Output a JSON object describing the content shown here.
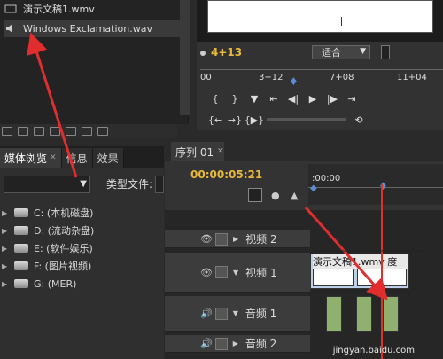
{
  "project": {
    "items": [
      {
        "label": "演示文稿1.wmv",
        "icon": "video-file-icon"
      },
      {
        "label": "Windows Exclamation.wav",
        "icon": "audio-file-icon"
      }
    ]
  },
  "media_browser": {
    "tabs": [
      {
        "label": "媒体浏览",
        "active": true
      },
      {
        "label": "信息",
        "active": false
      },
      {
        "label": "效果",
        "active": false
      }
    ],
    "type_label": "类型文件:",
    "drives": [
      "C: (本机磁盘)",
      "D: (流动杂盘)",
      "E: (软件娱乐)",
      "F: (图片视频)",
      "G: (MER)"
    ]
  },
  "monitor": {
    "timecode": "4+13",
    "fit": "适合",
    "ruler": [
      "00",
      "3+12",
      "7+08",
      "11+04"
    ]
  },
  "sequence": {
    "tab_label": "序列 01",
    "timecode": "00:00:05:21",
    "ruler_tc": ":00:00",
    "tracks": {
      "video2": "视频 2",
      "video1": "视频 1",
      "audio1": "音频 1",
      "audio2": "音频 2"
    },
    "side_label": "V",
    "clip_name": "演示文稿1.wmv 度"
  },
  "watermark": "jingyan.baidu.com",
  "colors": {
    "accent": "#e8b83a",
    "playhead": "#dd3322",
    "arrow": "#e02d2d"
  }
}
